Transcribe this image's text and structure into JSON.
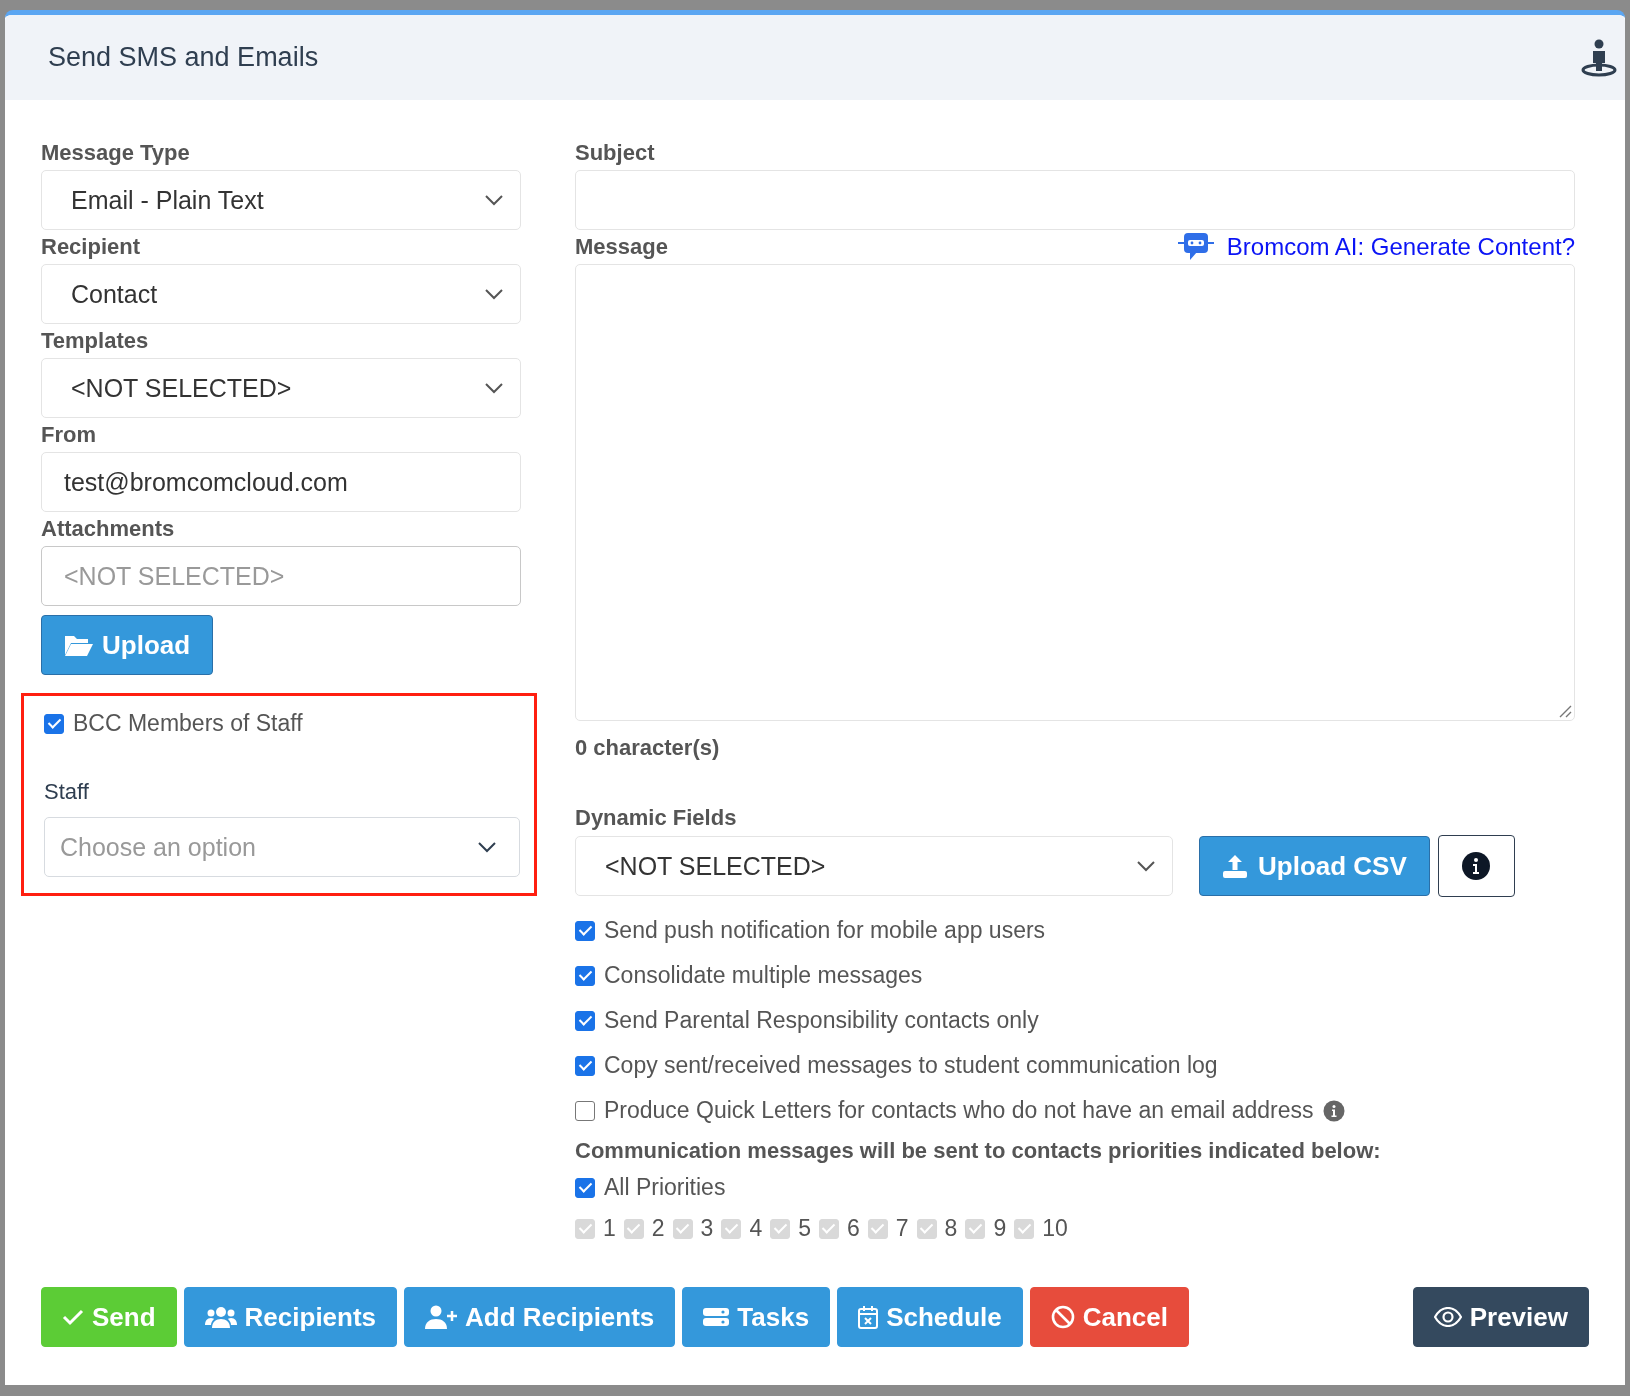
{
  "window": {
    "title": "Send SMS and Emails"
  },
  "left": {
    "fields": [
      {
        "label": "Message Type",
        "kind": "select",
        "value": "Email - Plain Text"
      },
      {
        "label": "Recipient",
        "kind": "select",
        "value": "Contact"
      },
      {
        "label": "Templates",
        "kind": "select",
        "value": "<NOT SELECTED>"
      },
      {
        "label": "From",
        "kind": "input",
        "value": "test@bromcomcloud.com"
      },
      {
        "label": "Attachments",
        "kind": "input",
        "placeholder": "<NOT SELECTED>"
      }
    ],
    "upload_button": "Upload",
    "bcc": {
      "highlight": true,
      "checkbox": {
        "label": "BCC Members of Staff",
        "checked": true
      },
      "staff_label": "Staff",
      "staff_placeholder": "Choose an option"
    }
  },
  "right": {
    "subject_label": "Subject",
    "message_label": "Message",
    "ai_link": "Bromcom AI: Generate Content?",
    "char_count": "0 character(s)",
    "dynamic_fields_label": "Dynamic Fields",
    "dynamic_fields_value": "<NOT SELECTED>",
    "upload_csv_button": "Upload CSV",
    "options": [
      {
        "label": "Send push notification for mobile app users",
        "checked": true,
        "info": false
      },
      {
        "label": "Consolidate multiple messages",
        "checked": true,
        "info": false
      },
      {
        "label": "Send Parental Responsibility contacts only",
        "checked": true,
        "info": false
      },
      {
        "label": "Copy sent/received messages to student communication log",
        "checked": true,
        "info": false
      },
      {
        "label": "Produce Quick Letters for contacts who do not have an email address",
        "checked": false,
        "info": true
      }
    ],
    "priorities_note": "Communication messages will be sent to contacts priorities indicated below:",
    "all_priorities": {
      "label": "All Priorities",
      "checked": true
    },
    "priorities": [
      {
        "label": "1",
        "checked": true,
        "disabled": true
      },
      {
        "label": "2",
        "checked": true,
        "disabled": true
      },
      {
        "label": "3",
        "checked": true,
        "disabled": true
      },
      {
        "label": "4",
        "checked": true,
        "disabled": true
      },
      {
        "label": "5",
        "checked": true,
        "disabled": true
      },
      {
        "label": "6",
        "checked": true,
        "disabled": true
      },
      {
        "label": "7",
        "checked": true,
        "disabled": true
      },
      {
        "label": "8",
        "checked": true,
        "disabled": true
      },
      {
        "label": "9",
        "checked": true,
        "disabled": true
      },
      {
        "label": "10",
        "checked": true,
        "disabled": true
      }
    ]
  },
  "footer": {
    "buttons": [
      {
        "label": "Send",
        "kind": "check",
        "color": "#5ccc36"
      },
      {
        "label": "Recipients",
        "kind": "users",
        "color": "#3498db"
      },
      {
        "label": "Add Recipients",
        "kind": "user-plus",
        "color": "#3498db"
      },
      {
        "label": "Tasks",
        "kind": "tasks",
        "color": "#3498db"
      },
      {
        "label": "Schedule",
        "kind": "calendar",
        "color": "#3498db"
      },
      {
        "label": "Cancel",
        "kind": "ban",
        "color": "#e74c3c"
      }
    ],
    "preview_button": {
      "label": "Preview",
      "kind": "eye",
      "color": "#34495e"
    }
  }
}
